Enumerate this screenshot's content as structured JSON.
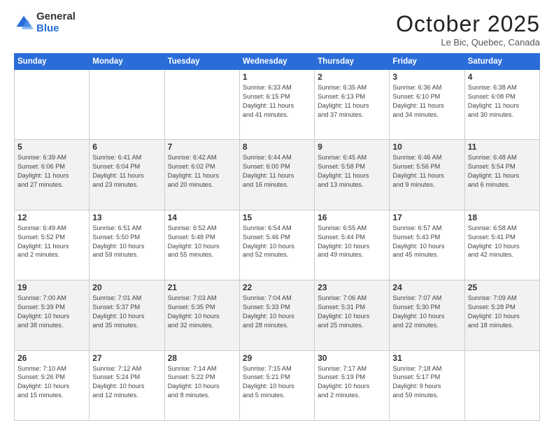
{
  "header": {
    "logo_general": "General",
    "logo_blue": "Blue",
    "month": "October 2025",
    "location": "Le Bic, Quebec, Canada"
  },
  "days_of_week": [
    "Sunday",
    "Monday",
    "Tuesday",
    "Wednesday",
    "Thursday",
    "Friday",
    "Saturday"
  ],
  "weeks": [
    [
      {
        "day": "",
        "info": ""
      },
      {
        "day": "",
        "info": ""
      },
      {
        "day": "",
        "info": ""
      },
      {
        "day": "1",
        "info": "Sunrise: 6:33 AM\nSunset: 6:15 PM\nDaylight: 11 hours\nand 41 minutes."
      },
      {
        "day": "2",
        "info": "Sunrise: 6:35 AM\nSunset: 6:13 PM\nDaylight: 11 hours\nand 37 minutes."
      },
      {
        "day": "3",
        "info": "Sunrise: 6:36 AM\nSunset: 6:10 PM\nDaylight: 11 hours\nand 34 minutes."
      },
      {
        "day": "4",
        "info": "Sunrise: 6:38 AM\nSunset: 6:08 PM\nDaylight: 11 hours\nand 30 minutes."
      }
    ],
    [
      {
        "day": "5",
        "info": "Sunrise: 6:39 AM\nSunset: 6:06 PM\nDaylight: 11 hours\nand 27 minutes."
      },
      {
        "day": "6",
        "info": "Sunrise: 6:41 AM\nSunset: 6:04 PM\nDaylight: 11 hours\nand 23 minutes."
      },
      {
        "day": "7",
        "info": "Sunrise: 6:42 AM\nSunset: 6:02 PM\nDaylight: 11 hours\nand 20 minutes."
      },
      {
        "day": "8",
        "info": "Sunrise: 6:44 AM\nSunset: 6:00 PM\nDaylight: 11 hours\nand 16 minutes."
      },
      {
        "day": "9",
        "info": "Sunrise: 6:45 AM\nSunset: 5:58 PM\nDaylight: 11 hours\nand 13 minutes."
      },
      {
        "day": "10",
        "info": "Sunrise: 6:46 AM\nSunset: 5:56 PM\nDaylight: 11 hours\nand 9 minutes."
      },
      {
        "day": "11",
        "info": "Sunrise: 6:48 AM\nSunset: 5:54 PM\nDaylight: 11 hours\nand 6 minutes."
      }
    ],
    [
      {
        "day": "12",
        "info": "Sunrise: 6:49 AM\nSunset: 5:52 PM\nDaylight: 11 hours\nand 2 minutes."
      },
      {
        "day": "13",
        "info": "Sunrise: 6:51 AM\nSunset: 5:50 PM\nDaylight: 10 hours\nand 59 minutes."
      },
      {
        "day": "14",
        "info": "Sunrise: 6:52 AM\nSunset: 5:48 PM\nDaylight: 10 hours\nand 55 minutes."
      },
      {
        "day": "15",
        "info": "Sunrise: 6:54 AM\nSunset: 5:46 PM\nDaylight: 10 hours\nand 52 minutes."
      },
      {
        "day": "16",
        "info": "Sunrise: 6:55 AM\nSunset: 5:44 PM\nDaylight: 10 hours\nand 49 minutes."
      },
      {
        "day": "17",
        "info": "Sunrise: 6:57 AM\nSunset: 5:43 PM\nDaylight: 10 hours\nand 45 minutes."
      },
      {
        "day": "18",
        "info": "Sunrise: 6:58 AM\nSunset: 5:41 PM\nDaylight: 10 hours\nand 42 minutes."
      }
    ],
    [
      {
        "day": "19",
        "info": "Sunrise: 7:00 AM\nSunset: 5:39 PM\nDaylight: 10 hours\nand 38 minutes."
      },
      {
        "day": "20",
        "info": "Sunrise: 7:01 AM\nSunset: 5:37 PM\nDaylight: 10 hours\nand 35 minutes."
      },
      {
        "day": "21",
        "info": "Sunrise: 7:03 AM\nSunset: 5:35 PM\nDaylight: 10 hours\nand 32 minutes."
      },
      {
        "day": "22",
        "info": "Sunrise: 7:04 AM\nSunset: 5:33 PM\nDaylight: 10 hours\nand 28 minutes."
      },
      {
        "day": "23",
        "info": "Sunrise: 7:06 AM\nSunset: 5:31 PM\nDaylight: 10 hours\nand 25 minutes."
      },
      {
        "day": "24",
        "info": "Sunrise: 7:07 AM\nSunset: 5:30 PM\nDaylight: 10 hours\nand 22 minutes."
      },
      {
        "day": "25",
        "info": "Sunrise: 7:09 AM\nSunset: 5:28 PM\nDaylight: 10 hours\nand 18 minutes."
      }
    ],
    [
      {
        "day": "26",
        "info": "Sunrise: 7:10 AM\nSunset: 5:26 PM\nDaylight: 10 hours\nand 15 minutes."
      },
      {
        "day": "27",
        "info": "Sunrise: 7:12 AM\nSunset: 5:24 PM\nDaylight: 10 hours\nand 12 minutes."
      },
      {
        "day": "28",
        "info": "Sunrise: 7:14 AM\nSunset: 5:22 PM\nDaylight: 10 hours\nand 8 minutes."
      },
      {
        "day": "29",
        "info": "Sunrise: 7:15 AM\nSunset: 5:21 PM\nDaylight: 10 hours\nand 5 minutes."
      },
      {
        "day": "30",
        "info": "Sunrise: 7:17 AM\nSunset: 5:19 PM\nDaylight: 10 hours\nand 2 minutes."
      },
      {
        "day": "31",
        "info": "Sunrise: 7:18 AM\nSunset: 5:17 PM\nDaylight: 9 hours\nand 59 minutes."
      },
      {
        "day": "",
        "info": ""
      }
    ]
  ]
}
